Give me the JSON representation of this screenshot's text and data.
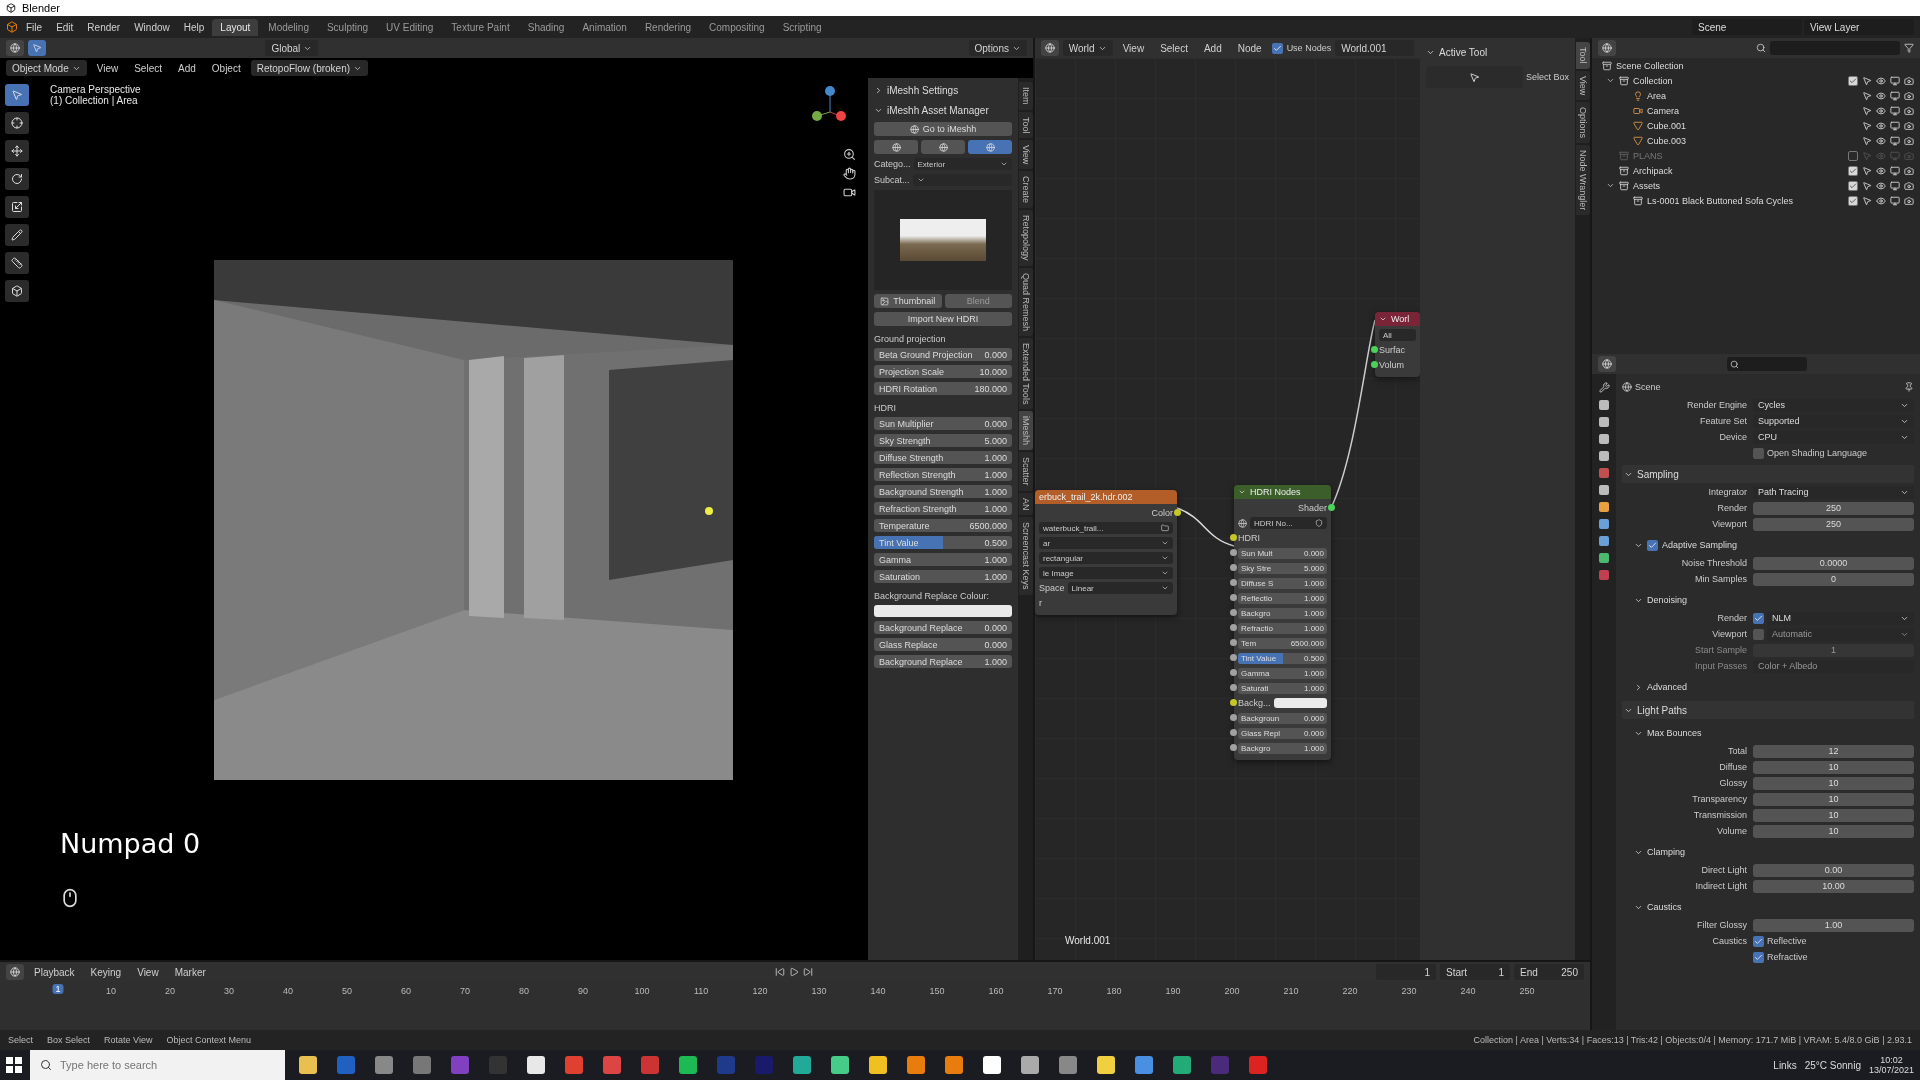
{
  "title_bar": {
    "title": "Blender"
  },
  "menu": [
    "File",
    "Edit",
    "Render",
    "Window",
    "Help"
  ],
  "workspaces": [
    {
      "label": "Layout",
      "selected": true
    },
    {
      "label": "Modeling",
      "selected": false
    },
    {
      "label": "Sculpting",
      "selected": false
    },
    {
      "label": "UV Editing",
      "selected": false
    },
    {
      "label": "Texture Paint",
      "selected": false
    },
    {
      "label": "Shading",
      "selected": false
    },
    {
      "label": "Animation",
      "selected": false
    },
    {
      "label": "Rendering",
      "selected": false
    },
    {
      "label": "Compositing",
      "selected": false
    },
    {
      "label": "Scripting",
      "selected": false
    }
  ],
  "scene": "Scene",
  "view_layer": "View Layer",
  "viewport_header": {
    "orientation": "Global",
    "options": "Options",
    "mode": "Object Mode",
    "menus": [
      "View",
      "Select",
      "Add",
      "Object"
    ],
    "addon": "RetopoFlow (broken)"
  },
  "viewport": {
    "camera_label": "Camera Perspective",
    "collection_label": "(1) Collection | Area",
    "key_hint": "Numpad 0"
  },
  "npanel": {
    "sections": [
      {
        "label": "iMeshh Settings",
        "expanded": false
      },
      {
        "label": "iMeshh Asset Manager",
        "expanded": true
      }
    ],
    "go_button": "Go to iMeshh",
    "mode_buttons": [
      {
        "selected": false
      },
      {
        "selected": false
      },
      {
        "selected": true
      }
    ],
    "category": {
      "label": "Catego...",
      "value": "Exterior"
    },
    "subcategory": {
      "label": "Subcat..."
    },
    "thumbnail_button": "Thumbnail",
    "blend_button": {
      "label": "Blend",
      "disabled": true
    },
    "import_button": "Import New HDRI",
    "groups": [
      {
        "heading": "Ground projection",
        "fields": [
          {
            "label": "Beta Ground Projection",
            "value": "0.000",
            "kind": "number"
          },
          {
            "label": "Projection Scale",
            "value": "10.000",
            "kind": "number"
          },
          {
            "label": "HDRI Rotation",
            "value": "180.000",
            "kind": "number"
          }
        ]
      },
      {
        "heading": "HDRI",
        "fields": [
          {
            "label": "Sun Multiplier",
            "value": "0.000",
            "kind": "number"
          },
          {
            "label": "Sky Strength",
            "value": "5.000",
            "kind": "number"
          },
          {
            "label": "Diffuse Strength",
            "value": "1.000",
            "kind": "number"
          },
          {
            "label": "Reflection Strength",
            "value": "1.000",
            "kind": "number"
          },
          {
            "label": "Background Strength",
            "value": "1.000",
            "kind": "number"
          },
          {
            "label": "Refraction Strength",
            "value": "1.000",
            "kind": "number"
          },
          {
            "label": "Temperature",
            "value": "6500.000",
            "kind": "number"
          },
          {
            "label": "Tint Value",
            "value": "0.500",
            "kind": "slider",
            "level": 0.5
          },
          {
            "label": "Gamma",
            "value": "1.000",
            "kind": "number"
          },
          {
            "label": "Saturation",
            "value": "1.000",
            "kind": "number"
          }
        ]
      }
    ],
    "colour_label": "Background Replace Colour:",
    "replace_fields": [
      {
        "label": "Background Replace",
        "value": "0.000"
      },
      {
        "label": "Glass Replace",
        "value": "0.000"
      },
      {
        "label": "Background Replace",
        "value": "1.000"
      }
    ],
    "tabs": [
      {
        "label": "Item",
        "selected": false
      },
      {
        "label": "Tool",
        "selected": false
      },
      {
        "label": "View",
        "selected": false
      },
      {
        "label": "Create",
        "selected": false
      },
      {
        "label": "Retopology",
        "selected": false
      },
      {
        "label": "Quad Remesh",
        "selected": false
      },
      {
        "label": "Extended Tools",
        "selected": false
      },
      {
        "label": "iMeshh",
        "selected": true
      },
      {
        "label": "Scatter",
        "selected": false
      },
      {
        "label": "AN",
        "selected": false
      },
      {
        "label": "Screencast Keys",
        "selected": false
      }
    ]
  },
  "node_header": {
    "type": "World",
    "menus": [
      "View",
      "Select",
      "Add",
      "Node"
    ],
    "use_nodes": {
      "label": "Use Nodes",
      "checked": true
    },
    "datablock": "World.001"
  },
  "image_node": {
    "title": "erbuck_trail_2k.hdr.002",
    "output": "Color",
    "file": "waterbuck_trail...",
    "dropdowns": [
      "ar",
      "rectangular",
      "le Image"
    ],
    "space_label": "Space",
    "space_value": "Linear",
    "footer": "r"
  },
  "hdri_node": {
    "title": "HDRI Nodes",
    "output": "Shader",
    "group": "HDRI No...",
    "input": "HDRI",
    "fields": [
      {
        "label": "Sun Mult",
        "value": "0.000",
        "kind": "number"
      },
      {
        "label": "Sky Stre",
        "value": "5.000",
        "kind": "number"
      },
      {
        "label": "Diffuse S",
        "value": "1.000",
        "kind": "number"
      },
      {
        "label": "Reflectio",
        "value": "1.000",
        "kind": "number"
      },
      {
        "label": "Backgro",
        "value": "1.000",
        "kind": "number"
      },
      {
        "label": "Refractio",
        "value": "1.000",
        "kind": "number"
      },
      {
        "label": "Tem",
        "value": "6500.000",
        "kind": "number"
      },
      {
        "label": "Tint Value",
        "value": "0.500",
        "kind": "slider",
        "level": 0.5
      },
      {
        "label": "Gamma",
        "value": "1.000",
        "kind": "number"
      },
      {
        "label": "Saturati",
        "value": "1.000",
        "kind": "number"
      },
      {
        "label": "Backg...",
        "kind": "color"
      },
      {
        "label": "Backgroun",
        "value": "0.000",
        "kind": "number"
      },
      {
        "label": "Glass Repl",
        "value": "0.000",
        "kind": "number"
      },
      {
        "label": "Backgro",
        "value": "1.000",
        "kind": "number"
      }
    ]
  },
  "output_node": {
    "title": "Worl",
    "target": "All",
    "inputs": [
      "Surfac",
      "Volum"
    ]
  },
  "node_footer": "World.001",
  "node_sidebar": {
    "title": "Active Tool",
    "tool": "Select Box",
    "tabs": [
      {
        "label": "Tool",
        "selected": true
      },
      {
        "label": "View",
        "selected": false
      },
      {
        "label": "Options",
        "selected": false
      },
      {
        "label": "Node Wrangler",
        "selected": false
      }
    ]
  },
  "outliner": {
    "root": "Scene Collection",
    "items": [
      {
        "label": "Collection",
        "kind": "collection",
        "checked": true,
        "expanded": true,
        "children": [
          {
            "label": "Area",
            "kind": "light"
          },
          {
            "label": "Camera",
            "kind": "camera"
          },
          {
            "label": "Cube.001",
            "kind": "mesh"
          },
          {
            "label": "Cube.003",
            "kind": "mesh"
          }
        ]
      },
      {
        "label": "PLANS",
        "kind": "collection",
        "checked": false
      },
      {
        "label": "Archipack",
        "kind": "collection",
        "checked": true
      },
      {
        "label": "Assets",
        "kind": "collection",
        "checked": true,
        "expanded": true,
        "children": [
          {
            "label": "Ls-0001 Black Buttoned Sofa Cycles",
            "kind": "collection",
            "checked": true
          }
        ]
      }
    ]
  },
  "properties": {
    "title": "Scene",
    "rows": [
      {
        "kind": "dropdown",
        "label": "Render Engine",
        "value": "Cycles"
      },
      {
        "kind": "dropdown",
        "label": "Feature Set",
        "value": "Supported"
      },
      {
        "kind": "dropdown",
        "label": "Device",
        "value": "CPU"
      },
      {
        "kind": "checkbox",
        "option": "Open Shading Language",
        "checked": false
      },
      {
        "kind": "section",
        "label": "Sampling",
        "expanded": true
      },
      {
        "kind": "dropdown",
        "label": "Integrator",
        "value": "Path Tracing"
      },
      {
        "kind": "number",
        "label": "Render",
        "value": "250"
      },
      {
        "kind": "number",
        "label": "Viewport",
        "value": "250"
      },
      {
        "kind": "check-subsection",
        "label": "Adaptive Sampling",
        "expanded": true,
        "checked": true
      },
      {
        "kind": "number",
        "label": "Noise Threshold",
        "value": "0.0000"
      },
      {
        "kind": "number",
        "label": "Min Samples",
        "value": "0"
      },
      {
        "kind": "subsection",
        "label": "Denoising",
        "expanded": true
      },
      {
        "kind": "check-dropdown",
        "label": "Render",
        "value": "NLM",
        "checked": true
      },
      {
        "kind": "check-dropdown",
        "label": "Viewport",
        "value": "Automatic",
        "checked": false
      },
      {
        "kind": "number",
        "label": "Start Sample",
        "value": "1",
        "disabled": true
      },
      {
        "kind": "text",
        "label": "Input Passes",
        "value": "Color + Albedo",
        "disabled": true
      },
      {
        "kind": "subsection",
        "label": "Advanced",
        "expanded": false
      },
      {
        "kind": "section",
        "label": "Light Paths",
        "expanded": true
      },
      {
        "kind": "subsection",
        "label": "Max Bounces",
        "expanded": true
      },
      {
        "kind": "number",
        "label": "Total",
        "value": "12"
      },
      {
        "kind": "number",
        "label": "Diffuse",
        "value": "10"
      },
      {
        "kind": "number",
        "label": "Glossy",
        "value": "10"
      },
      {
        "kind": "number",
        "label": "Transparency",
        "value": "10"
      },
      {
        "kind": "number",
        "label": "Transmission",
        "value": "10"
      },
      {
        "kind": "number",
        "label": "Volume",
        "value": "10"
      },
      {
        "kind": "subsection",
        "label": "Clamping",
        "expanded": true
      },
      {
        "kind": "number",
        "label": "Direct Light",
        "value": "0.00"
      },
      {
        "kind": "number",
        "label": "Indirect Light",
        "value": "10.00"
      },
      {
        "kind": "subsection",
        "label": "Caustics",
        "expanded": true
      },
      {
        "kind": "number",
        "label": "Filter Glossy",
        "value": "1.00"
      },
      {
        "kind": "checkbox",
        "label": "Caustics",
        "option": "Reflective",
        "checked": true
      },
      {
        "kind": "checkbox",
        "option": "Refractive",
        "checked": true
      }
    ]
  },
  "timeline": {
    "menus": [
      "Playback",
      "Keying",
      "View",
      "Marker"
    ],
    "frame": "1",
    "start_label": "Start",
    "start": "1",
    "end_label": "End",
    "end": "250",
    "current": "1",
    "ticks": [
      "10",
      "20",
      "30",
      "40",
      "50",
      "60",
      "70",
      "80",
      "90",
      "100",
      "110",
      "120",
      "130",
      "140",
      "150",
      "160",
      "170",
      "180",
      "190",
      "200",
      "210",
      "220",
      "230",
      "240",
      "250"
    ]
  },
  "status_bar": {
    "hints": [
      "Select",
      "Box Select",
      "Rotate View",
      "Object Context Menu"
    ],
    "stats": "Collection | Area | Verts:34 | Faces:13 | Tris:42 | Objects:0/4 | Memory: 171.7 MiB | VRAM: 5.4/8.0 GiB | 2.93.1"
  },
  "taskbar": {
    "search_placeholder": "Type here to search",
    "links": "Links",
    "weather": "25°C Sonnig",
    "time": "10:02",
    "date": "13/07/2021"
  }
}
